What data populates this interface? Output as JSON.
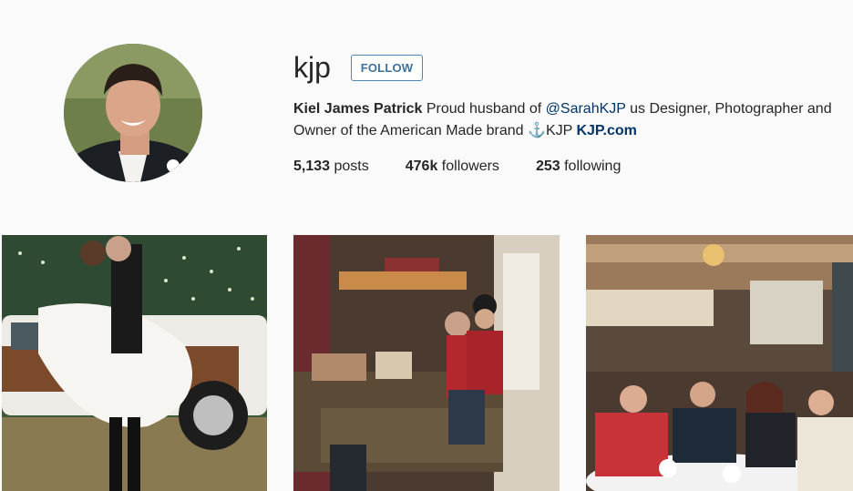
{
  "profile": {
    "username": "kjp",
    "follow_label": "FOLLOW",
    "full_name": "Kiel James Patrick",
    "bio_part1": "Proud husband of",
    "bio_mention": "@SarahKJP",
    "bio_part2": "us Designer, Photographer and Owner of the American Made brand ⚓KJP",
    "bio_link": "KJP.com"
  },
  "stats": {
    "posts_count": "5,133",
    "posts_label": "posts",
    "followers_count": "476k",
    "followers_label": "followers",
    "following_count": "253",
    "following_label": "following"
  }
}
